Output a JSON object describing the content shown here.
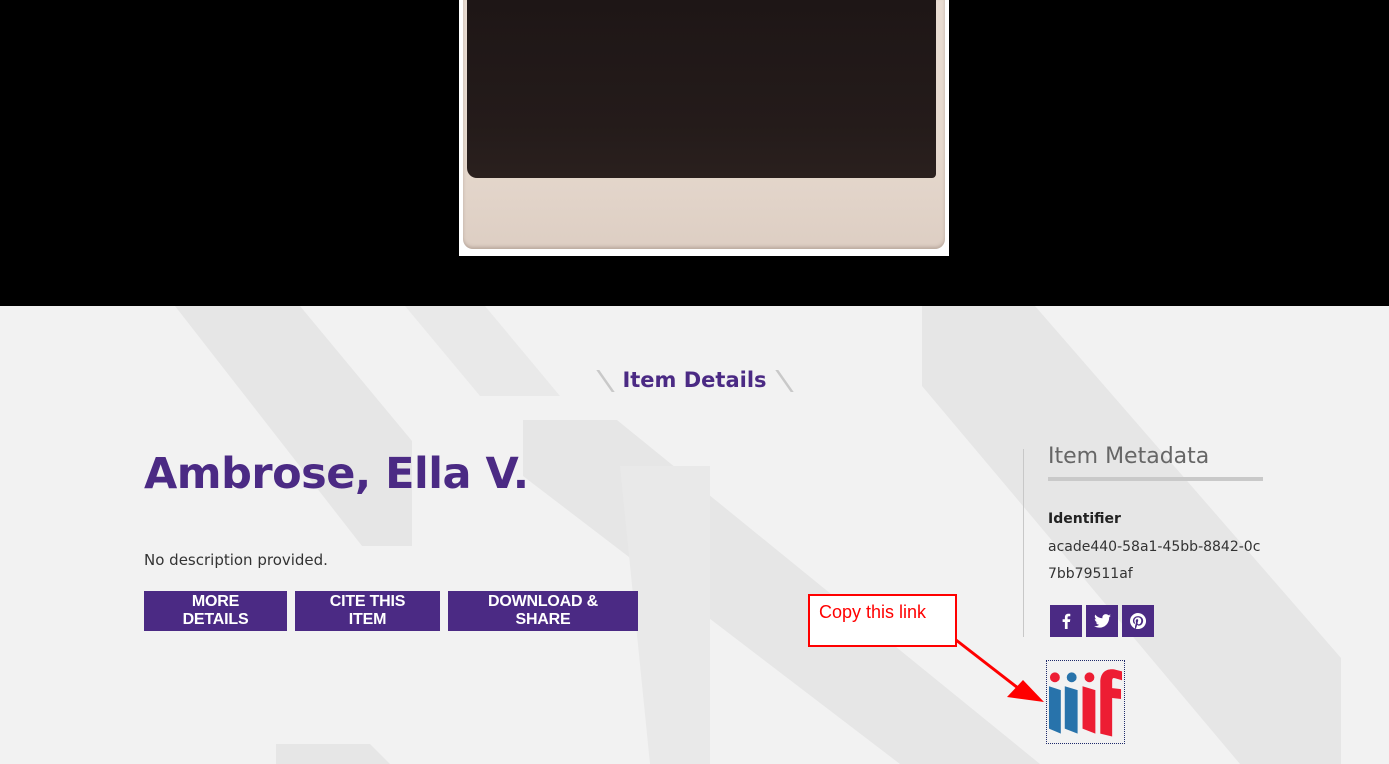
{
  "section": {
    "title": "Item Details"
  },
  "item": {
    "title": "Ambrose, Ella V.",
    "description": "No description provided."
  },
  "actions": {
    "more_details": "MORE DETAILS",
    "cite": "CITE THIS ITEM",
    "download_share": "DOWNLOAD & SHARE"
  },
  "metadata": {
    "heading": "Item Metadata",
    "identifier_label": "Identifier",
    "identifier_value": "acade440-58a1-45bb-8842-0c7bb79511af"
  },
  "social": {
    "icons": [
      "facebook-icon",
      "twitter-icon",
      "pinterest-icon"
    ]
  },
  "annotation": {
    "callout": "Copy this link"
  },
  "iiif": {
    "logo_text": "iiif"
  },
  "colors": {
    "brand_purple": "#4b2a84",
    "annotation_red": "#ff0000",
    "iiif_blue": "#2873ab",
    "iiif_red": "#ed1d33"
  }
}
